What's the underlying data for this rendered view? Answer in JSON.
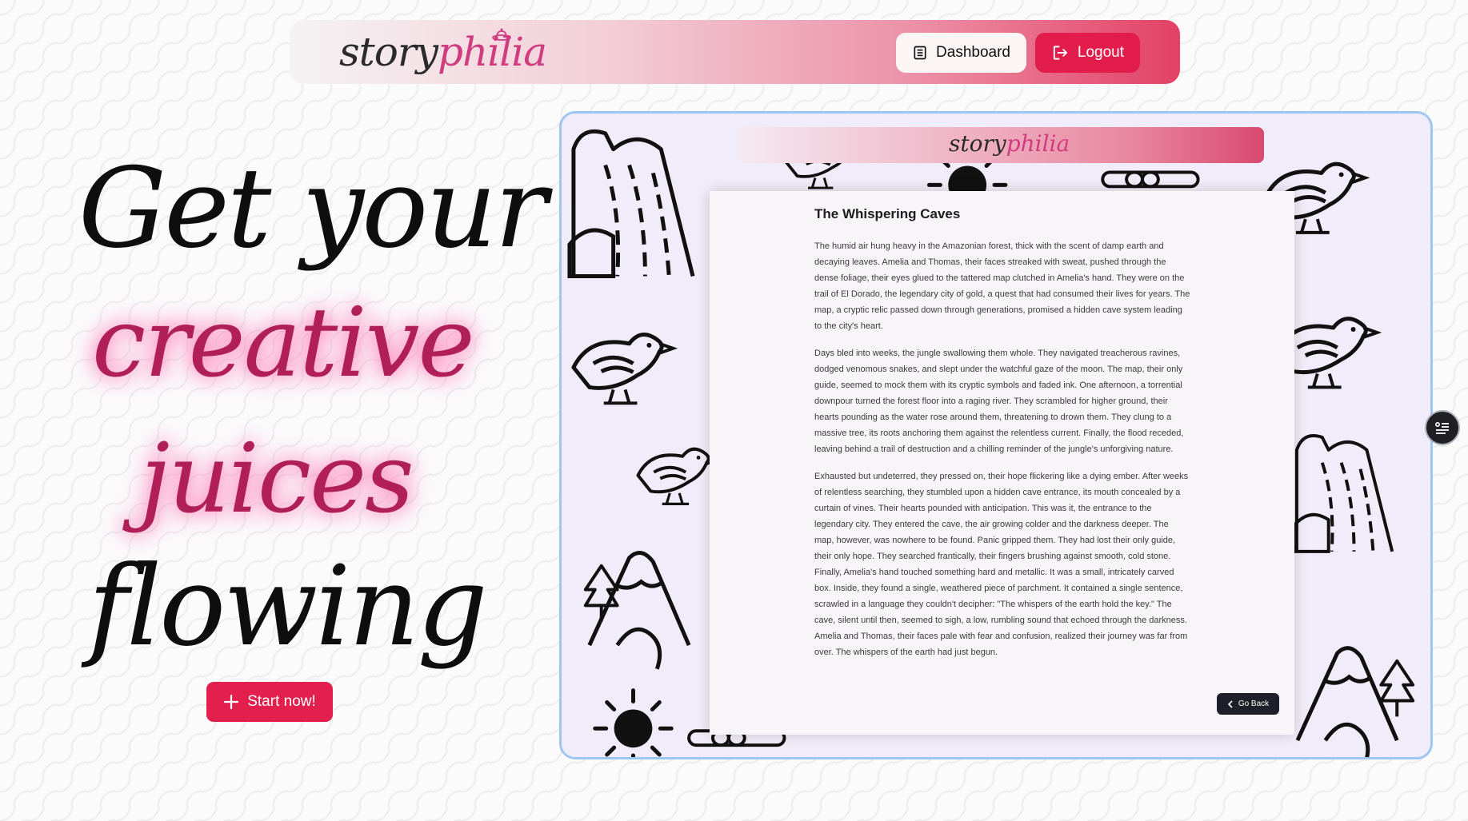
{
  "navbar": {
    "logo_part1": "story",
    "logo_part2": "philia",
    "dashboard_label": "Dashboard",
    "logout_label": "Logout"
  },
  "hero": {
    "line1": "Get your",
    "line2": "creative",
    "line3": "juices",
    "line4": "flowing",
    "start_label": "Start now!"
  },
  "preview": {
    "mini_logo_part1": "story",
    "mini_logo_part2": "philia",
    "story_title": "The Whispering Caves",
    "paragraphs": [
      "The humid air hung heavy in the Amazonian forest, thick with the scent of damp earth and decaying leaves. Amelia and Thomas, their faces streaked with sweat, pushed through the dense foliage, their eyes glued to the tattered map clutched in Amelia's hand. They were on the trail of El Dorado, the legendary city of gold, a quest that had consumed their lives for years. The map, a cryptic relic passed down through generations, promised a hidden cave system leading to the city's heart.",
      "Days bled into weeks, the jungle swallowing them whole. They navigated treacherous ravines, dodged venomous snakes, and slept under the watchful gaze of the moon. The map, their only guide, seemed to mock them with its cryptic symbols and faded ink. One afternoon, a torrential downpour turned the forest floor into a raging river. They scrambled for higher ground, their hearts pounding as the water rose around them, threatening to drown them. They clung to a massive tree, its roots anchoring them against the relentless current. Finally, the flood receded, leaving behind a trail of destruction and a chilling reminder of the jungle's unforgiving nature.",
      "Exhausted but undeterred, they pressed on, their hope flickering like a dying ember. After weeks of relentless searching, they stumbled upon a hidden cave entrance, its mouth concealed by a curtain of vines. Their hearts pounded with anticipation. This was it, the entrance to the legendary city. They entered the cave, the air growing colder and the darkness deeper. The map, however, was nowhere to be found. Panic gripped them. They had lost their only guide, their only hope. They searched frantically, their fingers brushing against smooth, cold stone. Finally, Amelia's hand touched something hard and metallic. It was a small, intricately carved box. Inside, they found a single, weathered piece of parchment. It contained a single sentence, scrawled in a language they couldn't decipher: \"The whispers of the earth hold the key.\" The cave, silent until then, seemed to sigh, a low, rumbling sound that echoed through the darkness. Amelia and Thomas, their faces pale with fear and confusion, realized their journey was far from over. The whispers of the earth had just begun."
    ],
    "go_back_label": "Go Back"
  },
  "icons": [
    "book-icon",
    "logout-icon",
    "plus-icon",
    "chevron-left-icon",
    "table-of-contents-icon"
  ],
  "colors": {
    "accent": "#e21d4c",
    "brand_pink": "#cf3d80",
    "glow_text": "#b01f58",
    "preview_border": "#9fc6f1"
  }
}
